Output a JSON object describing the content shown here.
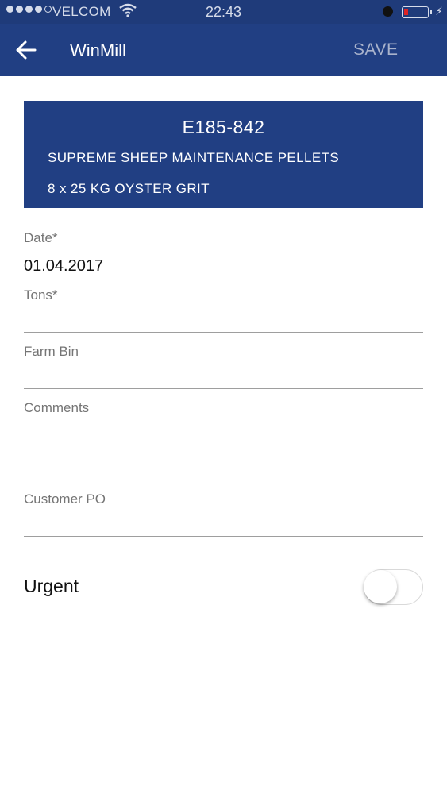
{
  "status_bar": {
    "carrier": "VELCOM",
    "time": "22:43"
  },
  "app_bar": {
    "title": "WinMill",
    "save_label": "SAVE"
  },
  "product": {
    "code": "E185-842",
    "name": "SUPREME SHEEP MAINTENANCE PELLETS",
    "pack": "8 x 25 KG OYSTER GRIT"
  },
  "form": {
    "date": {
      "label": "Date*",
      "value": "01.04.2017"
    },
    "tons": {
      "label": "Tons*",
      "value": ""
    },
    "farm_bin": {
      "label": "Farm Bin",
      "value": ""
    },
    "comments": {
      "label": "Comments",
      "value": ""
    },
    "customer_po": {
      "label": "Customer PO",
      "value": ""
    },
    "urgent": {
      "label": "Urgent",
      "on": false
    }
  },
  "colors": {
    "primary": "#213f83",
    "save_disabled": "#a9b3cc",
    "battery_low": "#e02424"
  },
  "icons": {
    "back": "arrow-left-icon",
    "wifi": "wifi-icon",
    "alarm": "alarm-icon",
    "battery": "battery-icon",
    "charging": "bolt-icon"
  }
}
